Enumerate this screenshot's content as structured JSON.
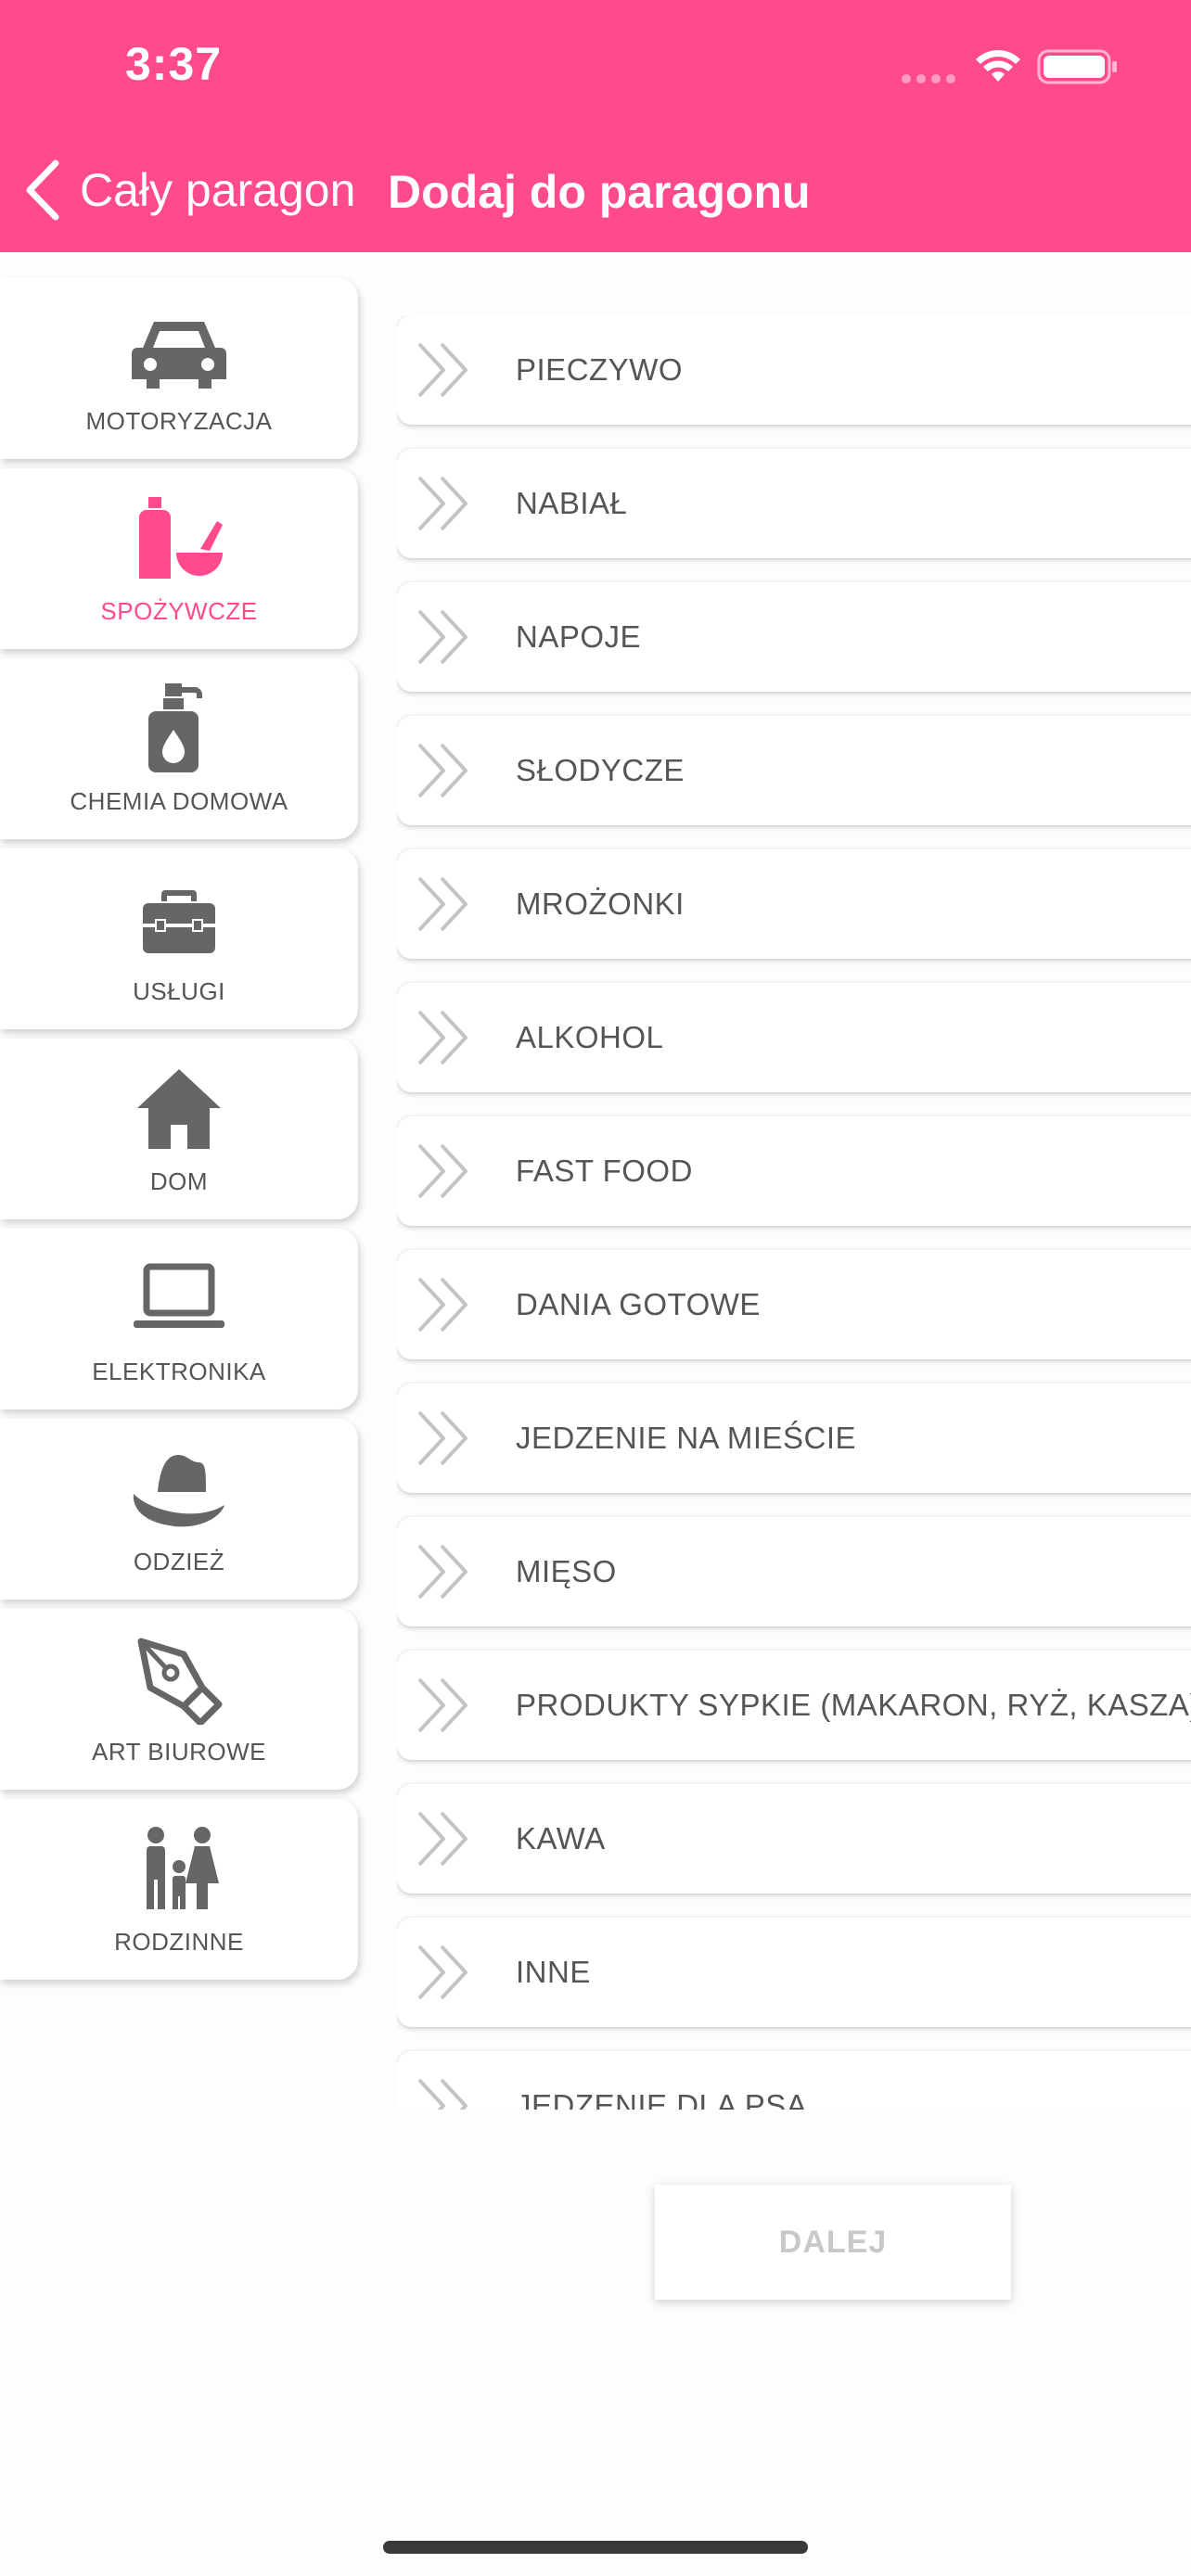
{
  "colors": {
    "accent": "#ff4a8d",
    "text": "#555555",
    "disabled": "#c8c8c8"
  },
  "status_bar": {
    "time": "3:37"
  },
  "nav": {
    "back_label": "Cały paragon",
    "title": "Dodaj do paragonu"
  },
  "categories": [
    {
      "label": "MOTORYZACJA",
      "icon": "car-icon",
      "active": false
    },
    {
      "label": "SPOŻYWCZE",
      "icon": "groceries-icon",
      "active": true
    },
    {
      "label": "CHEMIA DOMOWA",
      "icon": "soap-dispenser-icon",
      "active": false
    },
    {
      "label": "USŁUGI",
      "icon": "toolbox-icon",
      "active": false
    },
    {
      "label": "DOM",
      "icon": "home-icon",
      "active": false
    },
    {
      "label": "ELEKTRONIKA",
      "icon": "laptop-icon",
      "active": false
    },
    {
      "label": "ODZIEŻ",
      "icon": "hat-icon",
      "active": false
    },
    {
      "label": "ART BIUROWE",
      "icon": "pen-nib-icon",
      "active": false
    },
    {
      "label": "RODZINNE",
      "icon": "family-icon",
      "active": false
    }
  ],
  "subcategories": [
    "PIECZYWO",
    "NABIAŁ",
    "NAPOJE",
    "SŁODYCZE",
    "MROŻONKI",
    "ALKOHOL",
    "FAST FOOD",
    "DANIA GOTOWE",
    "JEDZENIE NA MIEŚCIE",
    "MIĘSO",
    "PRODUKTY SYPKIE (MAKARON, RYŻ, KASZA)",
    "KAWA",
    "INNE",
    "JEDZENIE DLA PSA"
  ],
  "next_button": {
    "label": "DALEJ",
    "enabled": false
  }
}
